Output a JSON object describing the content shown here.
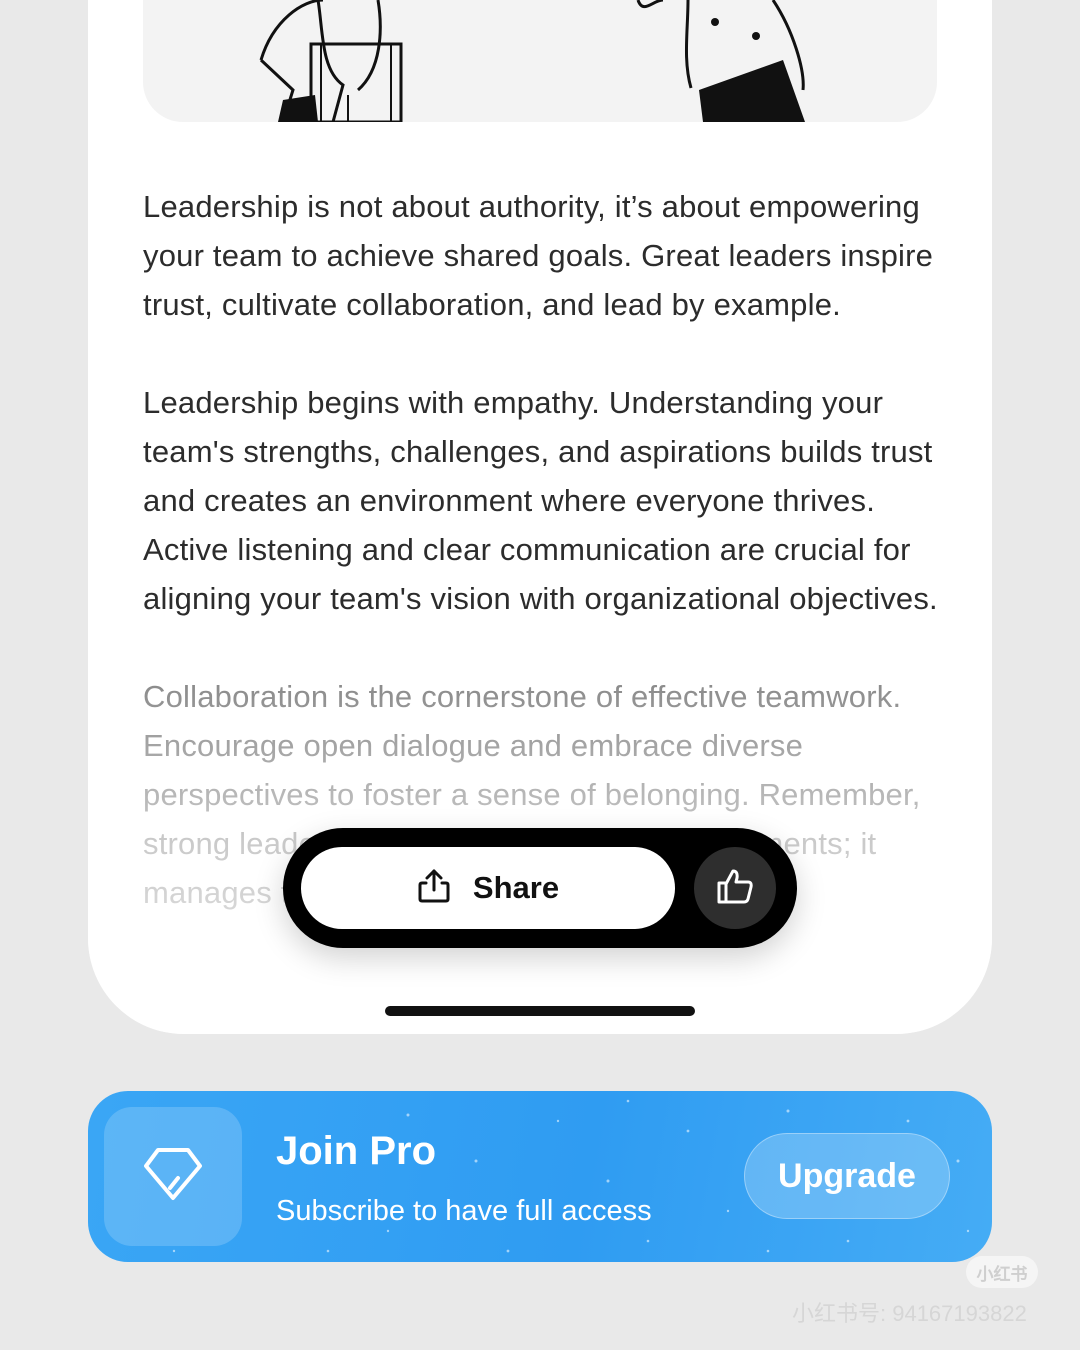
{
  "article": {
    "paragraphs": [
      "Leadership is not about authority, it’s about empowering your team to achieve shared goals. Great leaders inspire trust, cultivate collaboration, and lead by example.",
      "Leadership begins with empathy. Understanding your team's strengths, challenges, and aspirations builds trust and creates an environment where everyone thrives. Active listening and clear communication are crucial for aligning your team's vision with organizational objectives.",
      "Collaboration is the cornerstone of effective teamwork. Encourage open dialogue and embrace diverse perspectives to foster a sense of belonging. Remember, strong leadership doesn't eliminate disagreements; it manages them constructively."
    ]
  },
  "action_bar": {
    "share_label": "Share",
    "share_icon": "share-icon",
    "like_icon": "thumbs-up-icon"
  },
  "promo": {
    "title": "Join Pro",
    "subtitle": "Subscribe to have full access",
    "button_label": "Upgrade",
    "icon": "diamond-tag-icon",
    "color": "#2f9cf2"
  },
  "watermark": {
    "logo": "小红书",
    "id_text": "小红书号: 94167193822"
  }
}
